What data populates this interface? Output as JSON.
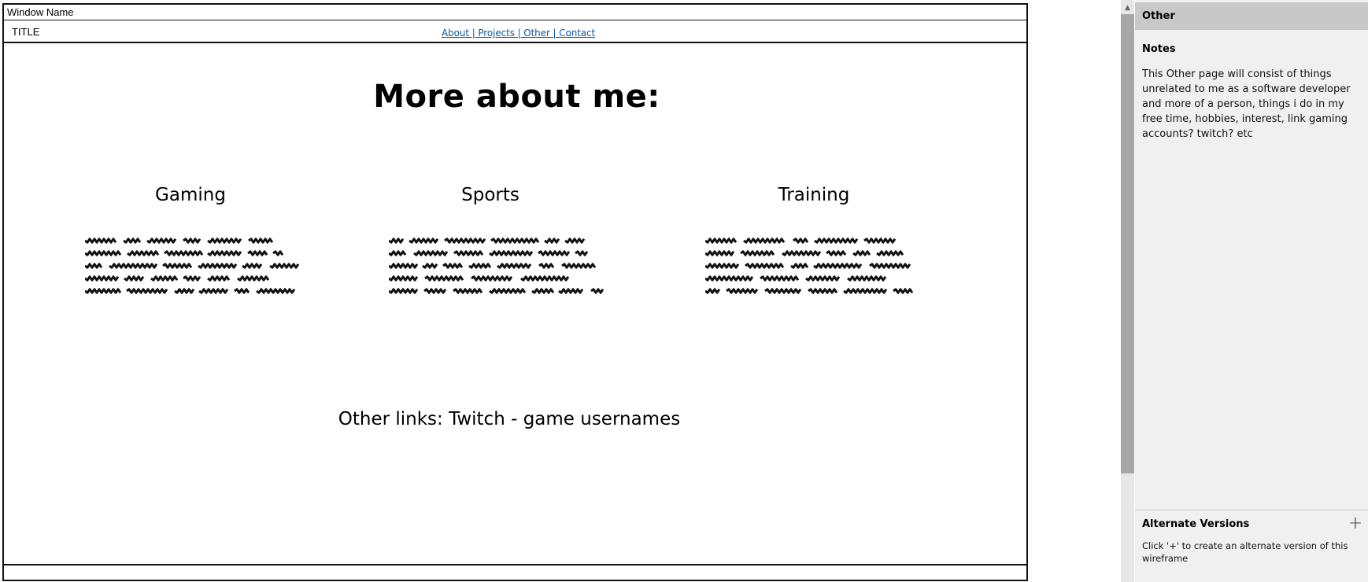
{
  "window": {
    "name": "Window Name"
  },
  "nav": {
    "title": "TITLE",
    "links": "About | Projects | Other | Contact"
  },
  "content": {
    "heading": "More about me:",
    "columns": [
      {
        "heading": "Gaming"
      },
      {
        "heading": "Sports"
      },
      {
        "heading": "Training"
      }
    ],
    "other_links": "Other links: Twitch - game usernames"
  },
  "panel": {
    "header": "Other",
    "notes_label": "Notes",
    "notes_text": "This Other page will consist of things unrelated to me as a software developer and more of a person, things i do in my free time, hobbies, interest, link gaming accounts? twitch? etc",
    "alt_label": "Alternate Versions",
    "alt_add_icon": "plus-icon",
    "alt_hint": "Click '+' to create an alternate version of this wireframe"
  },
  "colors": {
    "link": "#0b5aa5",
    "panel_bg": "#f0f0f0",
    "panel_header_bg": "#c8c8c8",
    "scroll_thumb": "#a7a7a7"
  }
}
